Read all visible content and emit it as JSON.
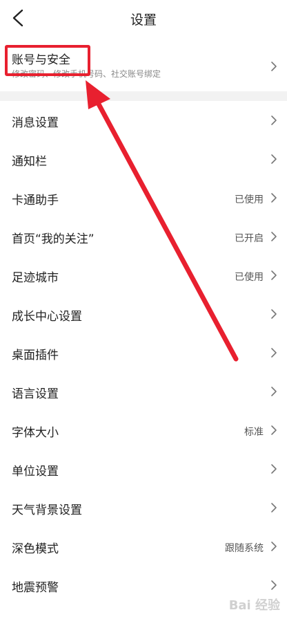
{
  "header": {
    "title": "设置"
  },
  "account": {
    "title": "账号与安全",
    "subtitle": "修改密码、修改手机号码、社交账号绑定"
  },
  "items": [
    {
      "label": "消息设置",
      "value": ""
    },
    {
      "label": "通知栏",
      "value": ""
    },
    {
      "label": "卡通助手",
      "value": "已使用"
    },
    {
      "label": "首页“我的关注”",
      "value": "已开启"
    },
    {
      "label": "足迹城市",
      "value": "已使用"
    },
    {
      "label": "成长中心设置",
      "value": ""
    },
    {
      "label": "桌面插件",
      "value": ""
    },
    {
      "label": "语言设置",
      "value": ""
    },
    {
      "label": "字体大小",
      "value": "标准"
    },
    {
      "label": "单位设置",
      "value": ""
    },
    {
      "label": "天气背景设置",
      "value": ""
    },
    {
      "label": "深色模式",
      "value": "跟随系统"
    },
    {
      "label": "地震预警",
      "value": ""
    }
  ],
  "watermark": "Bai 经验",
  "colors": {
    "annotation": "#e8202f",
    "divider": "#f2f2f2"
  }
}
